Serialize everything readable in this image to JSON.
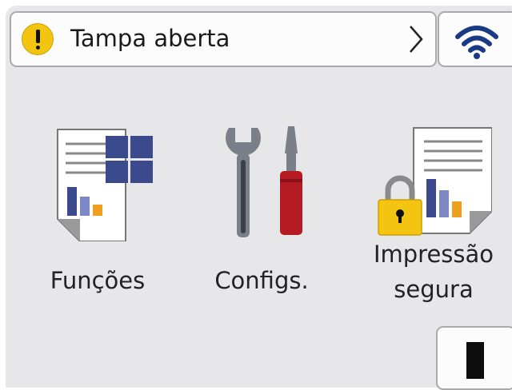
{
  "status": {
    "message": "Tampa aberta",
    "warning_color": "#f3c511"
  },
  "icons": {
    "warning": "warning-icon",
    "chevron": "chevron-right-icon",
    "wifi": "wifi-icon",
    "functions": "functions-icon",
    "settings": "wrench-screwdriver-icon",
    "secure_print": "secure-print-icon",
    "toner": "toner-icon"
  },
  "tiles": {
    "functions": "Funções",
    "settings": "Configs.",
    "secure_print_line1": "Impressão",
    "secure_print_line2": "segura"
  }
}
